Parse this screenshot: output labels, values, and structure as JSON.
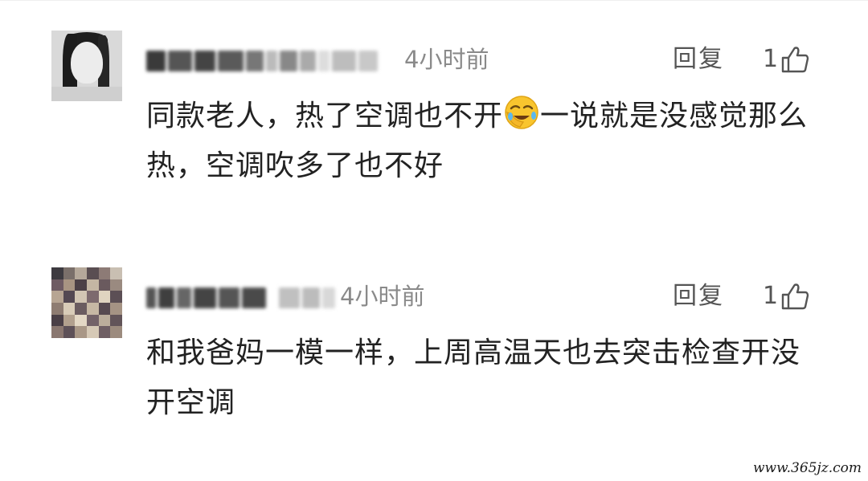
{
  "comments": [
    {
      "username_blurred": true,
      "time": "4小时前",
      "reply_label": "回复",
      "like_count": "1",
      "content_part1": "同款老人，热了空调也不开",
      "emoji_icon": "facepalm-laughing-emoji",
      "content_part2": "一说就是没感觉那么热，空调吹多了也不好"
    },
    {
      "username_blurred": true,
      "time": "4小时前",
      "reply_label": "回复",
      "like_count": "1",
      "content": "和我爸妈一模一样，上周高温天也去突击检查开没开空调"
    }
  ],
  "watermark": "www.365jz.com",
  "colors": {
    "meta_gray": "#8a8a8a",
    "action_gray": "#555555",
    "text": "#222222"
  }
}
